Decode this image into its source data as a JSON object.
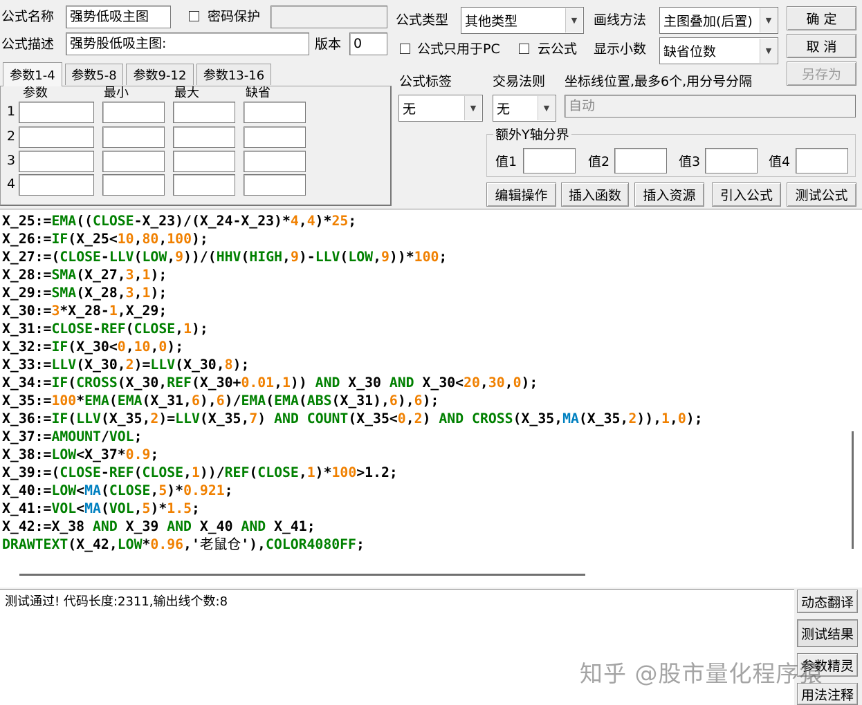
{
  "header": {
    "name_label": "公式名称",
    "name_value": "强势低吸主图",
    "password_label": "密码保护",
    "desc_label": "公式描述",
    "desc_value": "强势股低吸主图:",
    "version_label": "版本",
    "version_value": "0",
    "type_label": "公式类型",
    "type_value": "其他类型",
    "draw_label": "画线方法",
    "draw_value": "主图叠加(后置)",
    "pc_only_label": "公式只用于PC",
    "cloud_label": "云公式",
    "decimal_label": "显示小数",
    "decimal_value": "缺省位数",
    "ok_button": "确  定",
    "cancel_button": "取  消",
    "saveas_button": "另存为"
  },
  "params": {
    "tabs": [
      "参数1-4",
      "参数5-8",
      "参数9-12",
      "参数13-16"
    ],
    "columns": [
      "参数",
      "最小",
      "最大",
      "缺省"
    ],
    "rows": [
      "1",
      "2",
      "3",
      "4"
    ]
  },
  "options": {
    "tag_label": "公式标签",
    "tag_value": "无",
    "rule_label": "交易法则",
    "rule_value": "无",
    "axis_label": "坐标线位置,最多6个,用分号分隔",
    "axis_placeholder": "自动",
    "extra_y_label": "额外Y轴分界",
    "values": [
      "值1",
      "值2",
      "值3",
      "值4"
    ]
  },
  "actions": [
    "编辑操作",
    "插入函数",
    "插入资源",
    "引入公式",
    "测试公式"
  ],
  "code_lines": [
    [
      {
        "t": "X_25:="
      },
      {
        "t": "EMA",
        "c": "f"
      },
      {
        "t": "(("
      },
      {
        "t": "CLOSE",
        "c": "f"
      },
      {
        "t": "-X_23)/(X_24-X_23)*"
      },
      {
        "t": "4",
        "c": "n"
      },
      {
        "t": ","
      },
      {
        "t": "4",
        "c": "n"
      },
      {
        "t": ")*"
      },
      {
        "t": "25",
        "c": "n"
      },
      {
        "t": ";"
      }
    ],
    [
      {
        "t": "X_26:="
      },
      {
        "t": "IF",
        "c": "f"
      },
      {
        "t": "(X_25<"
      },
      {
        "t": "10",
        "c": "n"
      },
      {
        "t": ","
      },
      {
        "t": "80",
        "c": "n"
      },
      {
        "t": ","
      },
      {
        "t": "100",
        "c": "n"
      },
      {
        "t": ");"
      }
    ],
    [
      {
        "t": "X_27:=("
      },
      {
        "t": "CLOSE",
        "c": "f"
      },
      {
        "t": "-"
      },
      {
        "t": "LLV",
        "c": "f"
      },
      {
        "t": "("
      },
      {
        "t": "LOW",
        "c": "f"
      },
      {
        "t": ","
      },
      {
        "t": "9",
        "c": "n"
      },
      {
        "t": "))/("
      },
      {
        "t": "HHV",
        "c": "f"
      },
      {
        "t": "("
      },
      {
        "t": "HIGH",
        "c": "f"
      },
      {
        "t": ","
      },
      {
        "t": "9",
        "c": "n"
      },
      {
        "t": ")-"
      },
      {
        "t": "LLV",
        "c": "f"
      },
      {
        "t": "("
      },
      {
        "t": "LOW",
        "c": "f"
      },
      {
        "t": ","
      },
      {
        "t": "9",
        "c": "n"
      },
      {
        "t": "))*"
      },
      {
        "t": "100",
        "c": "n"
      },
      {
        "t": ";"
      }
    ],
    [
      {
        "t": "X_28:="
      },
      {
        "t": "SMA",
        "c": "f"
      },
      {
        "t": "(X_27,"
      },
      {
        "t": "3",
        "c": "n"
      },
      {
        "t": ","
      },
      {
        "t": "1",
        "c": "n"
      },
      {
        "t": ");"
      }
    ],
    [
      {
        "t": "X_29:="
      },
      {
        "t": "SMA",
        "c": "f"
      },
      {
        "t": "(X_28,"
      },
      {
        "t": "3",
        "c": "n"
      },
      {
        "t": ","
      },
      {
        "t": "1",
        "c": "n"
      },
      {
        "t": ");"
      }
    ],
    [
      {
        "t": "X_30:="
      },
      {
        "t": "3",
        "c": "n"
      },
      {
        "t": "*X_28-"
      },
      {
        "t": "1",
        "c": "n"
      },
      {
        "t": ",X_29;"
      }
    ],
    [
      {
        "t": "X_31:="
      },
      {
        "t": "CLOSE",
        "c": "f"
      },
      {
        "t": "-"
      },
      {
        "t": "REF",
        "c": "f"
      },
      {
        "t": "("
      },
      {
        "t": "CLOSE",
        "c": "f"
      },
      {
        "t": ","
      },
      {
        "t": "1",
        "c": "n"
      },
      {
        "t": ");"
      }
    ],
    [
      {
        "t": "X_32:="
      },
      {
        "t": "IF",
        "c": "f"
      },
      {
        "t": "(X_30<"
      },
      {
        "t": "0",
        "c": "n"
      },
      {
        "t": ","
      },
      {
        "t": "10",
        "c": "n"
      },
      {
        "t": ","
      },
      {
        "t": "0",
        "c": "n"
      },
      {
        "t": ");"
      }
    ],
    [
      {
        "t": "X_33:="
      },
      {
        "t": "LLV",
        "c": "f"
      },
      {
        "t": "(X_30,"
      },
      {
        "t": "2",
        "c": "n"
      },
      {
        "t": ")="
      },
      {
        "t": "LLV",
        "c": "f"
      },
      {
        "t": "(X_30,"
      },
      {
        "t": "8",
        "c": "n"
      },
      {
        "t": ");"
      }
    ],
    [
      {
        "t": "X_34:="
      },
      {
        "t": "IF",
        "c": "f"
      },
      {
        "t": "("
      },
      {
        "t": "CROSS",
        "c": "f"
      },
      {
        "t": "(X_30,"
      },
      {
        "t": "REF",
        "c": "f"
      },
      {
        "t": "(X_30+"
      },
      {
        "t": "0.01",
        "c": "n"
      },
      {
        "t": ","
      },
      {
        "t": "1",
        "c": "n"
      },
      {
        "t": ")) "
      },
      {
        "t": "AND",
        "c": "f"
      },
      {
        "t": " X_30 "
      },
      {
        "t": "AND",
        "c": "f"
      },
      {
        "t": " X_30<"
      },
      {
        "t": "20",
        "c": "n"
      },
      {
        "t": ","
      },
      {
        "t": "30",
        "c": "n"
      },
      {
        "t": ","
      },
      {
        "t": "0",
        "c": "n"
      },
      {
        "t": ");"
      }
    ],
    [
      {
        "t": "X_35:="
      },
      {
        "t": "100",
        "c": "n"
      },
      {
        "t": "*"
      },
      {
        "t": "EMA",
        "c": "f"
      },
      {
        "t": "("
      },
      {
        "t": "EMA",
        "c": "f"
      },
      {
        "t": "(X_31,"
      },
      {
        "t": "6",
        "c": "n"
      },
      {
        "t": "),"
      },
      {
        "t": "6",
        "c": "n"
      },
      {
        "t": ")/"
      },
      {
        "t": "EMA",
        "c": "f"
      },
      {
        "t": "("
      },
      {
        "t": "EMA",
        "c": "f"
      },
      {
        "t": "("
      },
      {
        "t": "ABS",
        "c": "f"
      },
      {
        "t": "(X_31),"
      },
      {
        "t": "6",
        "c": "n"
      },
      {
        "t": "),"
      },
      {
        "t": "6",
        "c": "n"
      },
      {
        "t": ");"
      }
    ],
    [
      {
        "t": "X_36:="
      },
      {
        "t": "IF",
        "c": "f"
      },
      {
        "t": "("
      },
      {
        "t": "LLV",
        "c": "f"
      },
      {
        "t": "(X_35,"
      },
      {
        "t": "2",
        "c": "n"
      },
      {
        "t": ")="
      },
      {
        "t": "LLV",
        "c": "f"
      },
      {
        "t": "(X_35,"
      },
      {
        "t": "7",
        "c": "n"
      },
      {
        "t": ") "
      },
      {
        "t": "AND",
        "c": "f"
      },
      {
        "t": " "
      },
      {
        "t": "COUNT",
        "c": "f"
      },
      {
        "t": "(X_35<"
      },
      {
        "t": "0",
        "c": "n"
      },
      {
        "t": ","
      },
      {
        "t": "2",
        "c": "n"
      },
      {
        "t": ") "
      },
      {
        "t": "AND",
        "c": "f"
      },
      {
        "t": " "
      },
      {
        "t": "CROSS",
        "c": "f"
      },
      {
        "t": "(X_35,"
      },
      {
        "t": "MA",
        "c": "b"
      },
      {
        "t": "(X_35,"
      },
      {
        "t": "2",
        "c": "n"
      },
      {
        "t": ")),"
      },
      {
        "t": "1",
        "c": "n"
      },
      {
        "t": ","
      },
      {
        "t": "0",
        "c": "n"
      },
      {
        "t": ");"
      }
    ],
    [
      {
        "t": "X_37:="
      },
      {
        "t": "AMOUNT",
        "c": "f"
      },
      {
        "t": "/"
      },
      {
        "t": "VOL",
        "c": "f"
      },
      {
        "t": ";"
      }
    ],
    [
      {
        "t": "X_38:="
      },
      {
        "t": "LOW",
        "c": "f"
      },
      {
        "t": "<X_37*"
      },
      {
        "t": "0.9",
        "c": "n"
      },
      {
        "t": ";"
      }
    ],
    [
      {
        "t": "X_39:=("
      },
      {
        "t": "CLOSE",
        "c": "f"
      },
      {
        "t": "-"
      },
      {
        "t": "REF",
        "c": "f"
      },
      {
        "t": "("
      },
      {
        "t": "CLOSE",
        "c": "f"
      },
      {
        "t": ","
      },
      {
        "t": "1",
        "c": "n"
      },
      {
        "t": "))/"
      },
      {
        "t": "REF",
        "c": "f"
      },
      {
        "t": "("
      },
      {
        "t": "CLOSE",
        "c": "f"
      },
      {
        "t": ","
      },
      {
        "t": "1",
        "c": "n"
      },
      {
        "t": ")*"
      },
      {
        "t": "100",
        "c": "n"
      },
      {
        "t": ">1.2;"
      }
    ],
    [
      {
        "t": "X_40:="
      },
      {
        "t": "LOW",
        "c": "f"
      },
      {
        "t": "<"
      },
      {
        "t": "MA",
        "c": "b"
      },
      {
        "t": "("
      },
      {
        "t": "CLOSE",
        "c": "f"
      },
      {
        "t": ","
      },
      {
        "t": "5",
        "c": "n"
      },
      {
        "t": ")*"
      },
      {
        "t": "0.921",
        "c": "n"
      },
      {
        "t": ";"
      }
    ],
    [
      {
        "t": "X_41:="
      },
      {
        "t": "VOL",
        "c": "f"
      },
      {
        "t": "<"
      },
      {
        "t": "MA",
        "c": "b"
      },
      {
        "t": "("
      },
      {
        "t": "VOL",
        "c": "f"
      },
      {
        "t": ","
      },
      {
        "t": "5",
        "c": "n"
      },
      {
        "t": ")*"
      },
      {
        "t": "1.5",
        "c": "n"
      },
      {
        "t": ";"
      }
    ],
    [
      {
        "t": "X_42:=X_38 "
      },
      {
        "t": "AND",
        "c": "f"
      },
      {
        "t": " X_39 "
      },
      {
        "t": "AND",
        "c": "f"
      },
      {
        "t": " X_40 "
      },
      {
        "t": "AND",
        "c": "f"
      },
      {
        "t": " X_41;"
      }
    ],
    [
      {
        "t": "DRAWTEXT",
        "c": "f"
      },
      {
        "t": "(X_42,"
      },
      {
        "t": "LOW",
        "c": "f"
      },
      {
        "t": "*"
      },
      {
        "t": "0.96",
        "c": "n"
      },
      {
        "t": ",'"
      },
      {
        "t": "老鼠仓",
        "c": "s"
      },
      {
        "t": "'),"
      },
      {
        "t": "COLOR4080FF",
        "c": "f"
      },
      {
        "t": ";"
      }
    ]
  ],
  "output_text": "测试通过! 代码长度:2311,输出线个数:8",
  "side_buttons": [
    "动态翻译",
    "测试结果",
    "参数精灵",
    "用法注释"
  ],
  "watermark": "知乎 @股市量化程序猿"
}
